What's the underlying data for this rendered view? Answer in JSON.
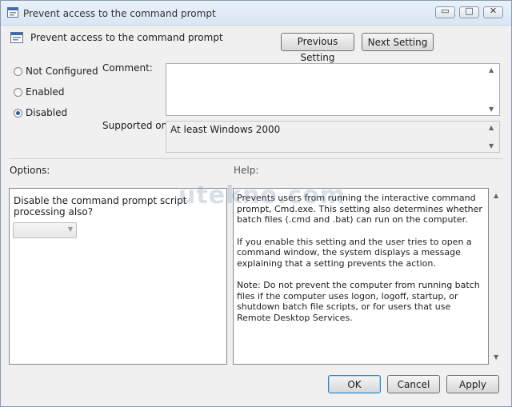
{
  "window": {
    "title": "Prevent access to the command prompt",
    "controls": {
      "minimize": "▭",
      "maximize": "□",
      "close": "✕"
    }
  },
  "header": {
    "setting_name": "Prevent access to the command prompt",
    "previous_label": "Previous Setting",
    "next_label": "Next Setting"
  },
  "state": {
    "options": [
      {
        "label": "Not Configured",
        "checked": false
      },
      {
        "label": "Enabled",
        "checked": false
      },
      {
        "label": "Disabled",
        "checked": true
      }
    ]
  },
  "comment": {
    "label": "Comment:",
    "value": ""
  },
  "supported": {
    "label": "Supported on:",
    "value": "At least Windows 2000"
  },
  "options_section": {
    "label": "Options:",
    "item_text": "Disable the command prompt script processing also?",
    "dropdown_value": ""
  },
  "help": {
    "label": "Help:",
    "paragraphs": [
      "Prevents users from running the interactive command prompt, Cmd.exe. This setting also determines whether batch files (.cmd and .bat) can run on the computer.",
      "If you enable this setting and the user tries to open a command window, the system displays a message explaining that a setting prevents the action.",
      "Note: Do not prevent the computer from running batch files if the computer uses logon, logoff, startup, or shutdown batch file scripts, or for users that use Remote Desktop Services."
    ]
  },
  "footer": {
    "ok": "OK",
    "cancel": "Cancel",
    "apply": "Apply"
  },
  "watermark": {
    "text": "utekno.com"
  },
  "colors": {
    "accent": "#2a5ea8",
    "title_bar": "#dbe7f5",
    "default_button_border": "#3c7fb1"
  },
  "icons": [
    "policy-icon",
    "minimize-icon",
    "maximize-icon",
    "close-icon",
    "scroll-up-icon",
    "scroll-down-icon",
    "dropdown-arrow-icon"
  ]
}
